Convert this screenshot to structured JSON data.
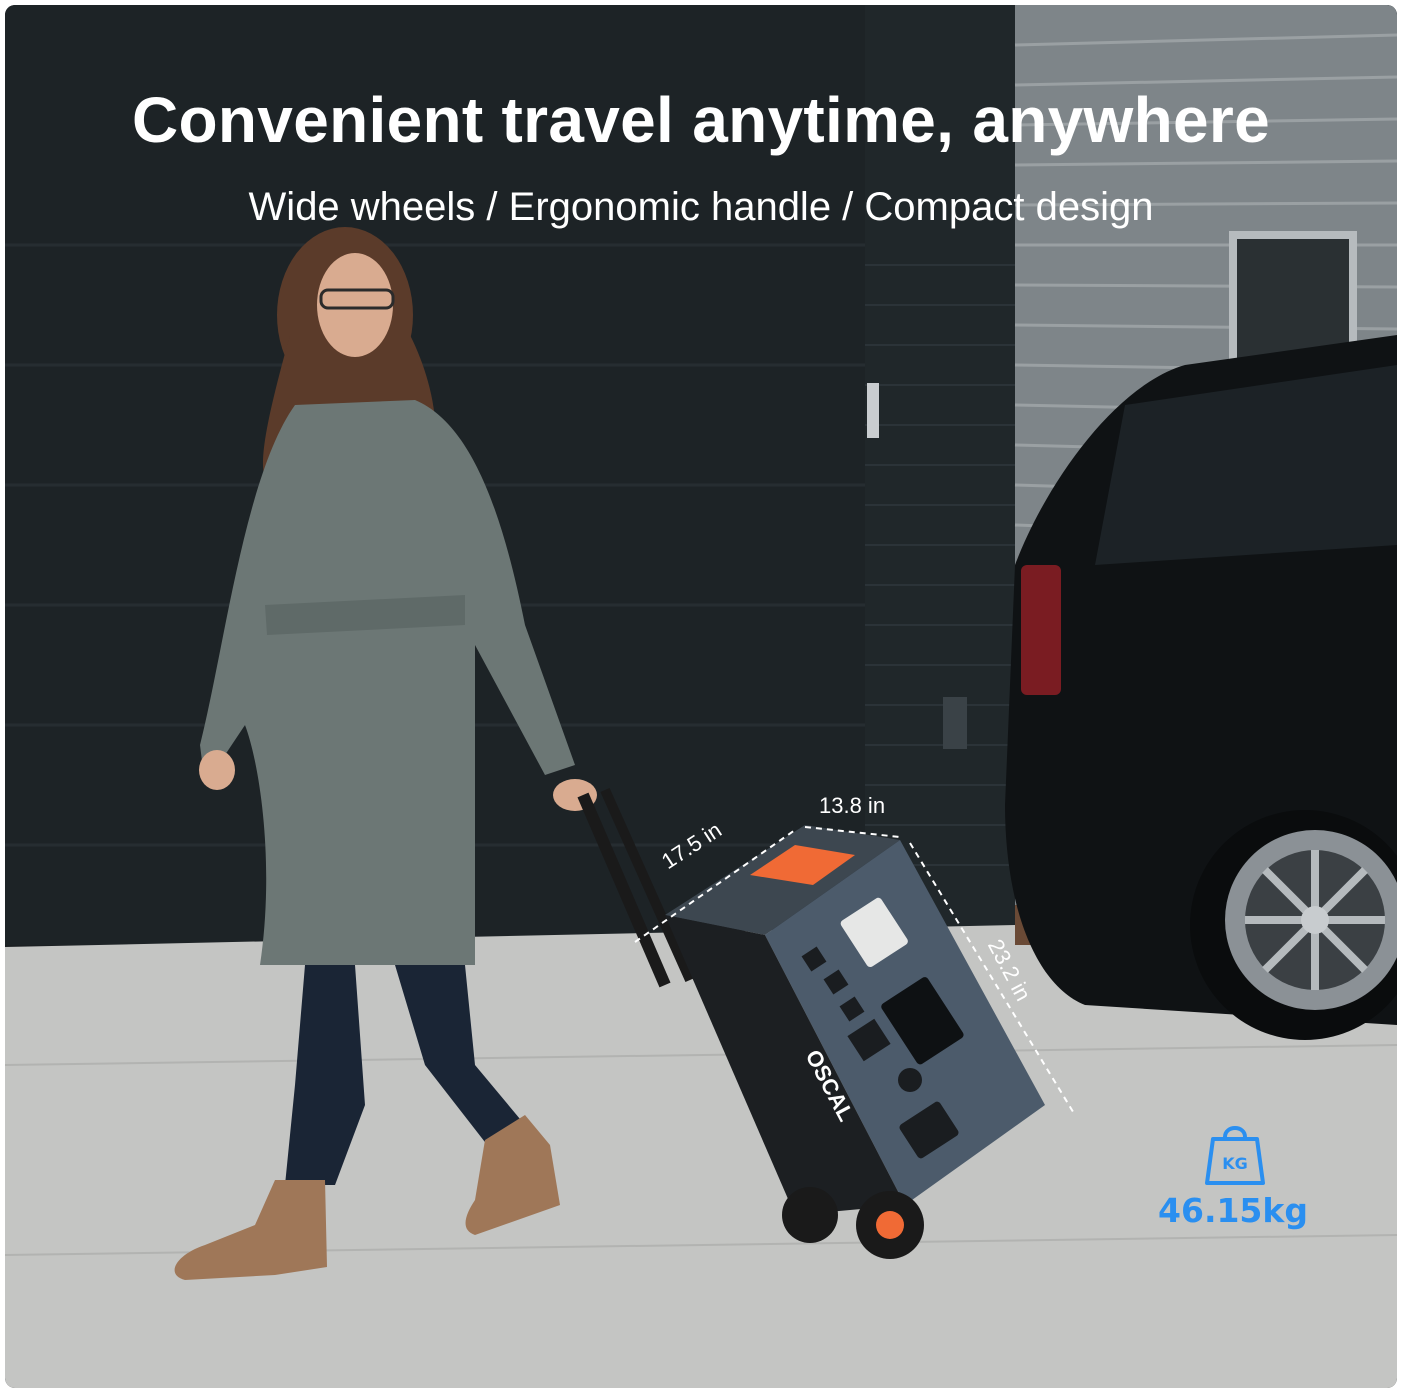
{
  "headline": "Convenient travel anytime, anywhere",
  "subheadline": "Wide wheels / Ergonomic handle / Compact design",
  "dimensions": {
    "width": "13.8 in",
    "depth": "17.5 in",
    "height": "23.2 in"
  },
  "weight": {
    "unit_badge": "KG",
    "value": "46.15kg",
    "icon": "weight-icon"
  },
  "product_brand": "OSCAL",
  "colors": {
    "accent_orange": "#f06a35",
    "weight_blue": "#2a8ff0",
    "device_body": "#4c5b6b"
  }
}
